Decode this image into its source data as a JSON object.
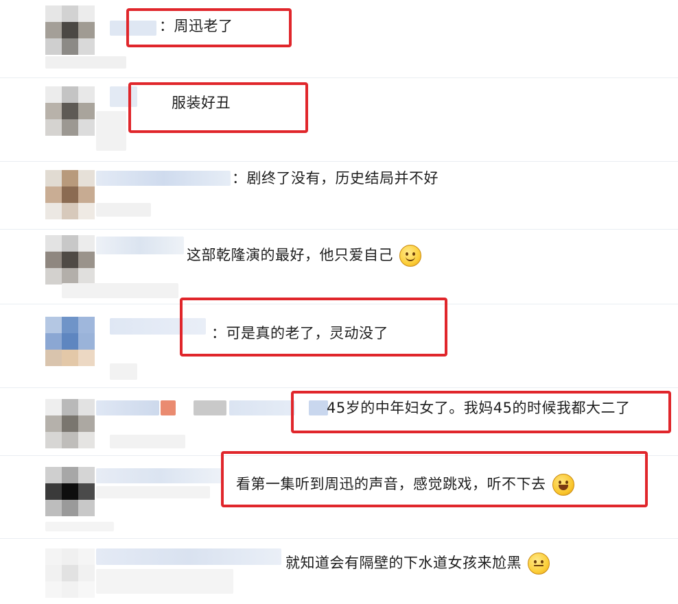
{
  "colors": {
    "highlight": "#e0262b",
    "divider": "#e9edf2",
    "text": "#1d1d1d"
  },
  "comments": [
    {
      "text": "：周迅老了",
      "emoji": null,
      "highlighted": true
    },
    {
      "text": "服装好丑",
      "emoji": null,
      "highlighted": true
    },
    {
      "text": "：剧终了没有，历史结局并不好",
      "emoji": null,
      "highlighted": false
    },
    {
      "text": "这部乾隆演的最好，他只爱自己",
      "emoji": "smile-icon",
      "highlighted": false
    },
    {
      "text": "：可是真的老了，灵动没了",
      "emoji": null,
      "highlighted": true
    },
    {
      "text": "45岁的中年妇女了。我妈45的时候我都大二了",
      "emoji": null,
      "highlighted": true
    },
    {
      "text": "看第一集听到周迅的声音，感觉跳戏，听不下去",
      "emoji": "laugh-cry-icon",
      "highlighted": true
    },
    {
      "text": "就知道会有隔壁的下水道女孩来尬黑",
      "emoji": "shush-icon",
      "highlighted": false
    }
  ]
}
